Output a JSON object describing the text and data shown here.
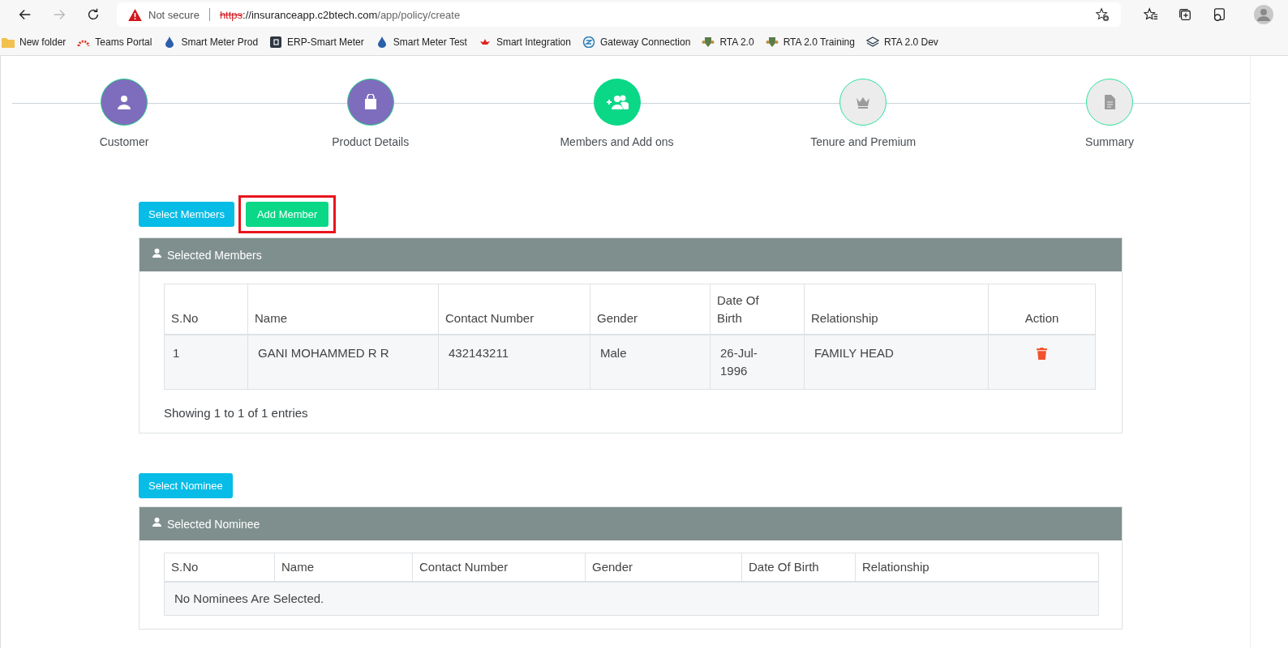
{
  "browser": {
    "security": "Not secure",
    "url_scheme": "https",
    "url_rest": "://insuranceapp.c2btech.com",
    "url_path": "/app/policy/create"
  },
  "bookmarks": [
    {
      "label": "New folder",
      "kind": "folder"
    },
    {
      "label": "Teams Portal",
      "kind": "arc"
    },
    {
      "label": "Smart Meter Prod",
      "kind": "drop"
    },
    {
      "label": "ERP-Smart Meter",
      "kind": "tile"
    },
    {
      "label": "Smart Meter Test",
      "kind": "drop"
    },
    {
      "label": "Smart Integration",
      "kind": "flower"
    },
    {
      "label": "Gateway Connection",
      "kind": "swirl"
    },
    {
      "label": "RTA 2.0",
      "kind": "crest"
    },
    {
      "label": "RTA 2.0 Training",
      "kind": "crest"
    },
    {
      "label": "RTA 2.0 Dev",
      "kind": "layers"
    }
  ],
  "steps": [
    {
      "label": "Customer",
      "done": true,
      "selected": false,
      "kind": "person"
    },
    {
      "label": "Product Details",
      "done": true,
      "selected": false,
      "kind": "bag"
    },
    {
      "label": "Members and Add ons",
      "done": false,
      "selected": true,
      "kind": "group"
    },
    {
      "label": "Tenure and Premium",
      "done": false,
      "selected": false,
      "kind": "crown"
    },
    {
      "label": "Summary",
      "done": false,
      "selected": false,
      "kind": "doc"
    }
  ],
  "member_buttons": [
    {
      "label": "Select Members",
      "kind": "info",
      "highlighted": false
    },
    {
      "label": "Add Member",
      "kind": "success",
      "highlighted": true
    }
  ],
  "members_panel": {
    "title": "Selected Members",
    "columns": [
      "S.No",
      "Name",
      "Contact Number",
      "Gender",
      "Date Of Birth",
      "Relationship",
      "Action"
    ],
    "rows": [
      {
        "sno": "1",
        "name": "GANI MOHAMMED R R",
        "contact": "432143211",
        "gender": "Male",
        "dob": "26-Jul-1996",
        "relationship": "FAMILY HEAD"
      }
    ],
    "footer": "Showing 1 to 1 of 1 entries"
  },
  "nominee_button": {
    "label": "Select Nominee"
  },
  "nominee_panel": {
    "title": "Selected Nominee",
    "columns": [
      "S.No",
      "Name",
      "Contact Number",
      "Gender",
      "Date Of Birth",
      "Relationship"
    ],
    "empty": "No Nominees Are Selected."
  }
}
